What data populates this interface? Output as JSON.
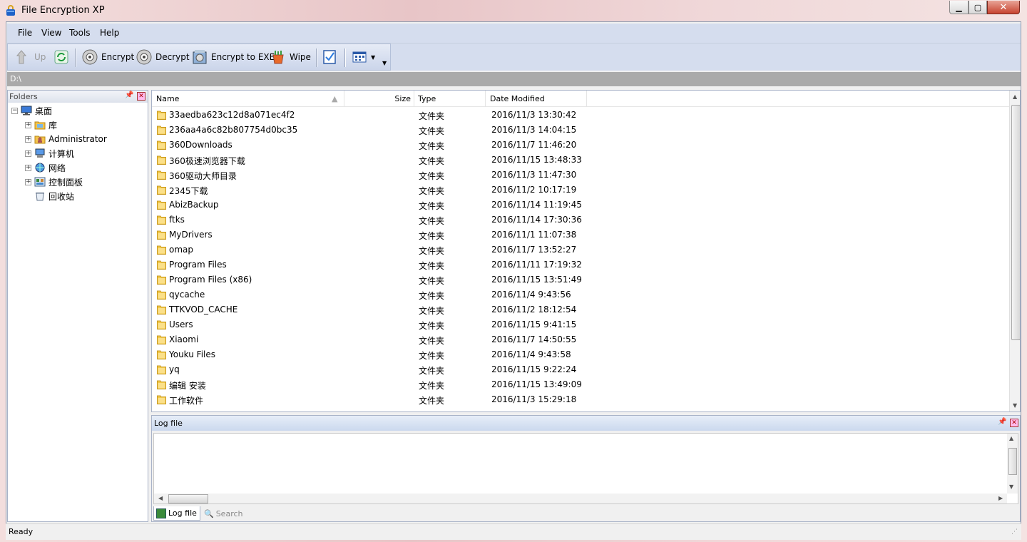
{
  "window": {
    "title": "File Encryption XP"
  },
  "menu": [
    "File",
    "View",
    "Tools",
    "Help"
  ],
  "toolbar": {
    "up": "Up",
    "encrypt": "Encrypt",
    "decrypt": "Decrypt",
    "encrypt_exe": "Encrypt to EXE",
    "wipe": "Wipe"
  },
  "path": "D:\\",
  "folders": {
    "title": "Folders",
    "items": [
      {
        "label": "桌面",
        "icon": "desktop-icon"
      },
      {
        "label": "库",
        "icon": "library-icon"
      },
      {
        "label": "Administrator",
        "icon": "user-icon"
      },
      {
        "label": "计算机",
        "icon": "computer-icon"
      },
      {
        "label": "网络",
        "icon": "network-icon"
      },
      {
        "label": "控制面板",
        "icon": "control-panel-icon"
      },
      {
        "label": "回收站",
        "icon": "recycle-bin-icon"
      }
    ]
  },
  "list": {
    "columns": {
      "name": "Name",
      "size": "Size",
      "type": "Type",
      "date": "Date Modified"
    },
    "rows": [
      {
        "name": "33aedba623c12d8a071ec4f2",
        "type": "文件夹",
        "date": "2016/11/3 13:30:42"
      },
      {
        "name": "236aa4a6c82b807754d0bc35",
        "type": "文件夹",
        "date": "2016/11/3 14:04:15"
      },
      {
        "name": "360Downloads",
        "type": "文件夹",
        "date": "2016/11/7 11:46:20"
      },
      {
        "name": "360极速浏览器下载",
        "type": "文件夹",
        "date": "2016/11/15 13:48:33"
      },
      {
        "name": "360驱动大师目录",
        "type": "文件夹",
        "date": "2016/11/3 11:47:30"
      },
      {
        "name": "2345下载",
        "type": "文件夹",
        "date": "2016/11/2 10:17:19"
      },
      {
        "name": "AbizBackup",
        "type": "文件夹",
        "date": "2016/11/14 11:19:45"
      },
      {
        "name": "ftks",
        "type": "文件夹",
        "date": "2016/11/14 17:30:36"
      },
      {
        "name": "MyDrivers",
        "type": "文件夹",
        "date": "2016/11/1 11:07:38"
      },
      {
        "name": "omap",
        "type": "文件夹",
        "date": "2016/11/7 13:52:27"
      },
      {
        "name": "Program Files",
        "type": "文件夹",
        "date": "2016/11/11 17:19:32"
      },
      {
        "name": "Program Files (x86)",
        "type": "文件夹",
        "date": "2016/11/15 13:51:49"
      },
      {
        "name": "qycache",
        "type": "文件夹",
        "date": "2016/11/4 9:43:56"
      },
      {
        "name": "TTKVOD_CACHE",
        "type": "文件夹",
        "date": "2016/11/2 18:12:54"
      },
      {
        "name": "Users",
        "type": "文件夹",
        "date": "2016/11/15 9:41:15"
      },
      {
        "name": "Xiaomi",
        "type": "文件夹",
        "date": "2016/11/7 14:50:55"
      },
      {
        "name": "Youku Files",
        "type": "文件夹",
        "date": "2016/11/4 9:43:58"
      },
      {
        "name": "yq",
        "type": "文件夹",
        "date": "2016/11/15 9:22:24"
      },
      {
        "name": "编辑 安装",
        "type": "文件夹",
        "date": "2016/11/15 13:49:09"
      },
      {
        "name": "工作软件",
        "type": "文件夹",
        "date": "2016/11/3 15:29:18"
      }
    ]
  },
  "log": {
    "title": "Log file",
    "tabs": [
      "Log file",
      "Search"
    ]
  },
  "status": "Ready"
}
